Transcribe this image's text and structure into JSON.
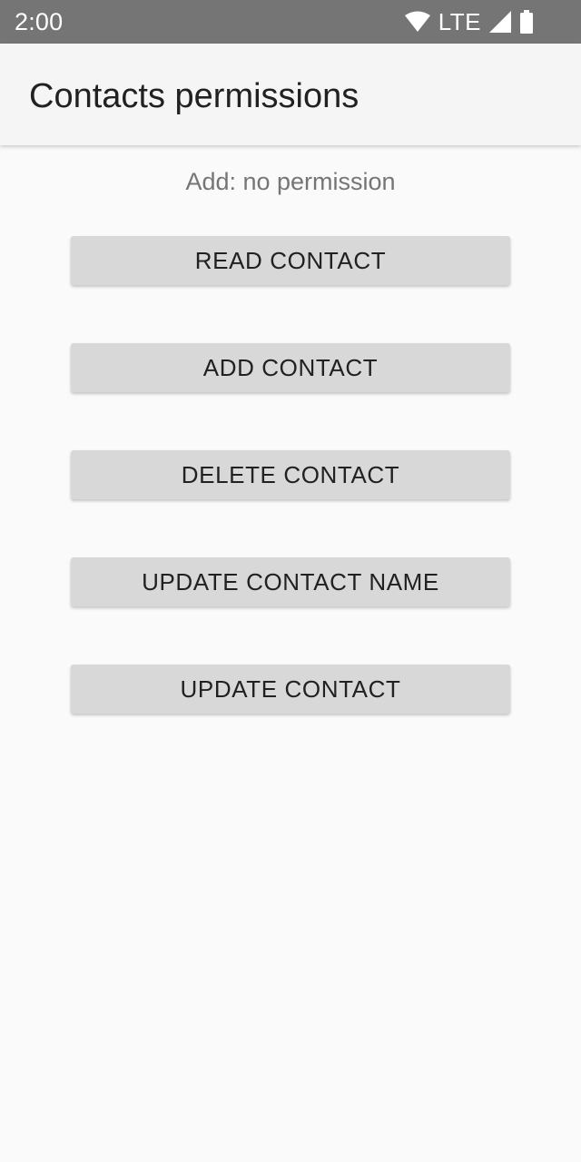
{
  "status_bar": {
    "time": "2:00",
    "network_label": "LTE",
    "icons": [
      "wifi-icon",
      "cell-signal-icon",
      "battery-icon"
    ]
  },
  "app_bar": {
    "title": "Contacts permissions"
  },
  "main": {
    "status_message": "Add: no permission",
    "buttons": [
      {
        "label": "READ CONTACT"
      },
      {
        "label": "ADD CONTACT"
      },
      {
        "label": "DELETE CONTACT"
      },
      {
        "label": "UPDATE CONTACT NAME"
      },
      {
        "label": "UPDATE CONTACT"
      }
    ]
  },
  "colors": {
    "status_bar": "#757575",
    "app_bar": "#f5f5f5",
    "background": "#fafafa",
    "button": "#d7d8d7",
    "text_primary": "#212121",
    "text_secondary": "#757575"
  }
}
